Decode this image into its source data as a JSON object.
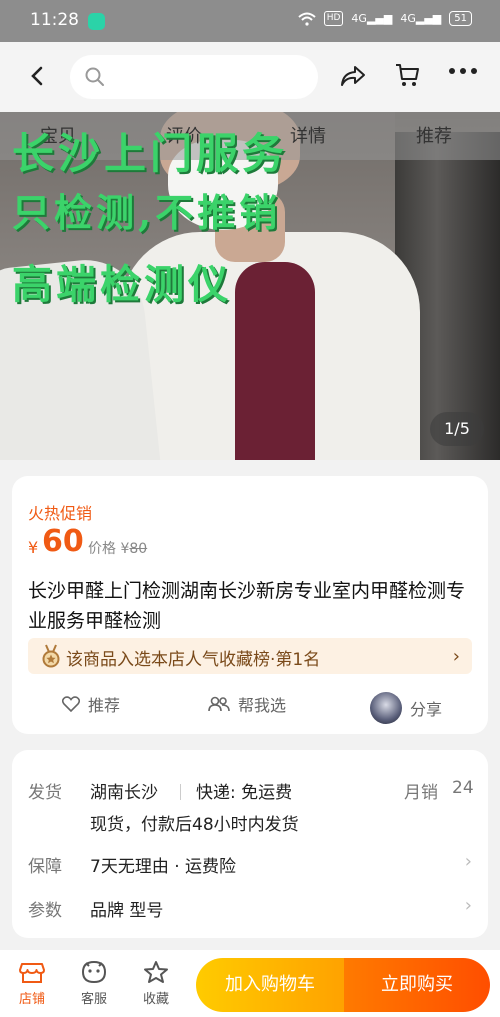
{
  "status_bar": {
    "time": "11:28",
    "hd": "HD",
    "signal1": "4G",
    "signal2": "4G",
    "battery": "51"
  },
  "nav": {
    "search_placeholder": ""
  },
  "hero": {
    "tabs": [
      "宝贝",
      "评价",
      "详情",
      "推荐"
    ],
    "overlay_lines": [
      "长沙上门服务",
      "只检测,不推销",
      "高端检测仪"
    ],
    "image_counter": "1/5"
  },
  "product": {
    "promo_label": "火热促销",
    "currency": "¥",
    "price": "60",
    "original_price_label": "价格 ¥",
    "original_price": "80",
    "title": "长沙甲醛上门检测湖南长沙新房专业室内甲醛检测专业服务甲醛检测",
    "rank_text": "该商品入选本店人气收藏榜·第1名",
    "actions": {
      "recommend": "推荐",
      "help_choose": "帮我选",
      "share": "分享"
    }
  },
  "details": {
    "shipping_label": "发货",
    "shipping_from": "湖南长沙",
    "express": "快递: 免运费",
    "monthly_sales_label": "月销",
    "monthly_sales": "24",
    "shipping_note": "现货，付款后48小时内发货",
    "guarantee_label": "保障",
    "guarantee_value": "7天无理由 · 运费险",
    "params_label": "参数",
    "params_value": "品牌 型号"
  },
  "bottom_bar": {
    "shop": "店铺",
    "service": "客服",
    "favorite": "收藏",
    "add_to_cart": "加入购物车",
    "buy_now": "立即购买"
  },
  "colors": {
    "accent": "#f05a14",
    "cart_button": "#ffb300",
    "buy_button": "#ff5a00",
    "promo_text": "#3bd36a"
  }
}
